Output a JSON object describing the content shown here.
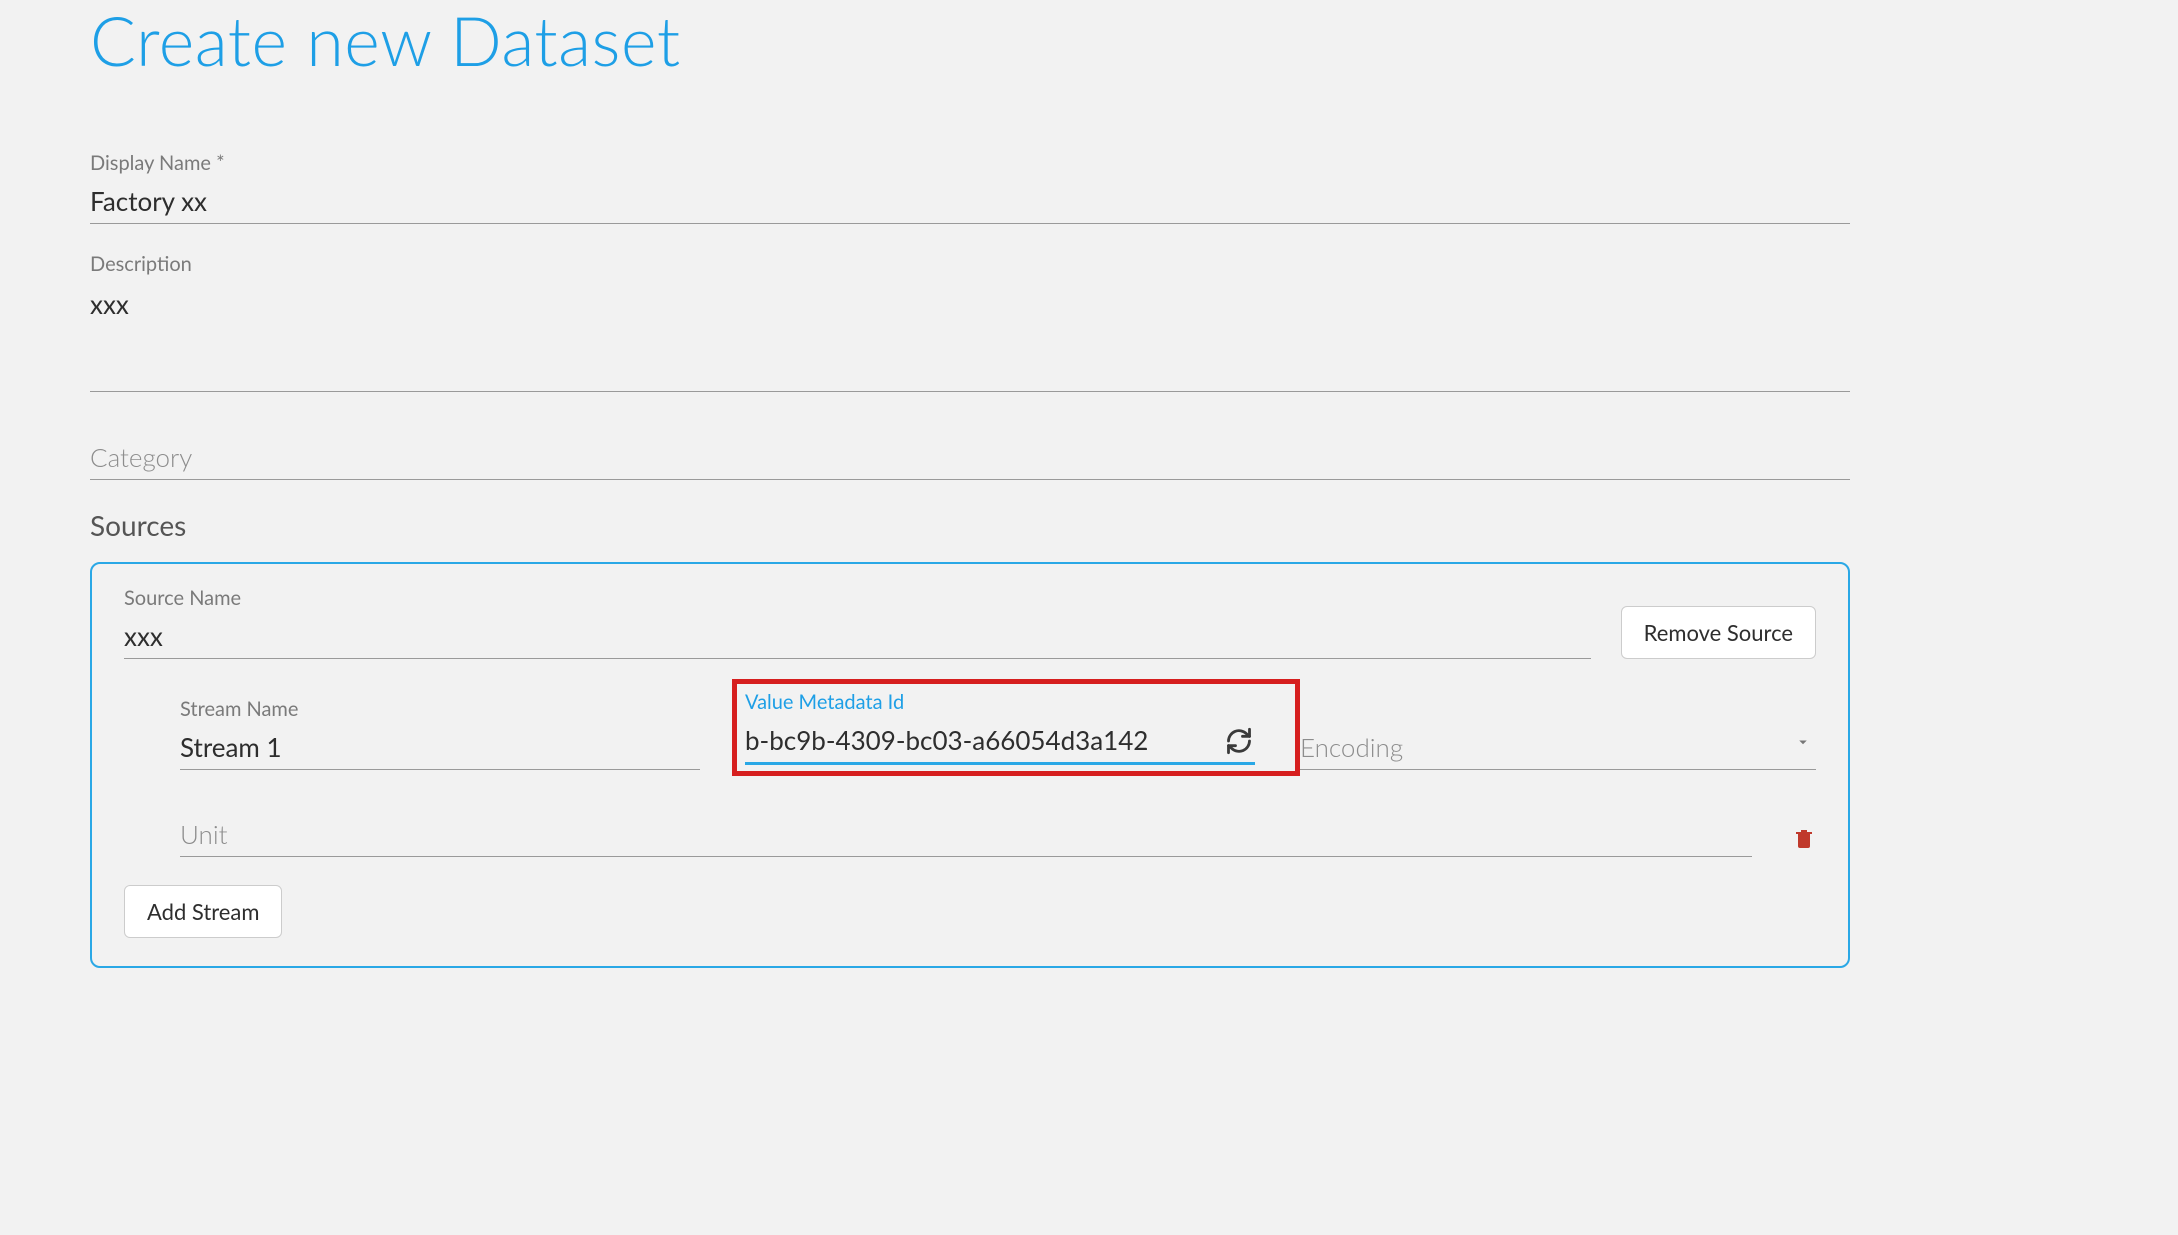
{
  "page": {
    "title": "Create new Dataset"
  },
  "fields": {
    "displayName": {
      "label": "Display Name *",
      "value": "Factory xx"
    },
    "description": {
      "label": "Description",
      "value": "xxx"
    },
    "category": {
      "placeholder": "Category",
      "value": ""
    }
  },
  "sources": {
    "heading": "Sources",
    "removeSourceLabel": "Remove Source",
    "addStreamLabel": "Add Stream",
    "source": {
      "nameLabel": "Source Name",
      "nameValue": "xxx",
      "stream": {
        "nameLabel": "Stream Name",
        "nameValue": "Stream 1",
        "metadataLabel": "Value Metadata Id",
        "metadataValue": "b-bc9b-4309-bc03-a66054d3a142",
        "encodingPlaceholder": "Encoding",
        "unitPlaceholder": "Unit"
      }
    }
  },
  "icons": {
    "refresh": "refresh-icon",
    "chevronDown": "chevron-down-icon",
    "trash": "trash-icon"
  }
}
